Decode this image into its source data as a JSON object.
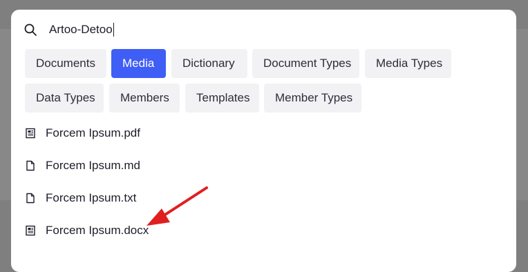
{
  "search": {
    "value": "Artoo-Detoo",
    "icon": "search-icon"
  },
  "filters": [
    {
      "label": "Documents",
      "active": false
    },
    {
      "label": "Media",
      "active": true
    },
    {
      "label": "Dictionary",
      "active": false
    },
    {
      "label": "Document Types",
      "active": false
    },
    {
      "label": "Media Types",
      "active": false
    },
    {
      "label": "Data Types",
      "active": false
    },
    {
      "label": "Members",
      "active": false
    },
    {
      "label": "Templates",
      "active": false
    },
    {
      "label": "Member Types",
      "active": false
    }
  ],
  "results": [
    {
      "label": "Forcem Ipsum.pdf",
      "icon": "document-lines-icon"
    },
    {
      "label": "Forcem Ipsum.md",
      "icon": "file-icon"
    },
    {
      "label": "Forcem Ipsum.txt",
      "icon": "file-icon"
    },
    {
      "label": "Forcem Ipsum.docx",
      "icon": "document-lines-icon"
    }
  ],
  "colors": {
    "accent": "#3f5ef5",
    "chip_background": "#f2f2f4",
    "annotation_arrow": "#e02020",
    "backdrop": "#7f7f7f"
  }
}
